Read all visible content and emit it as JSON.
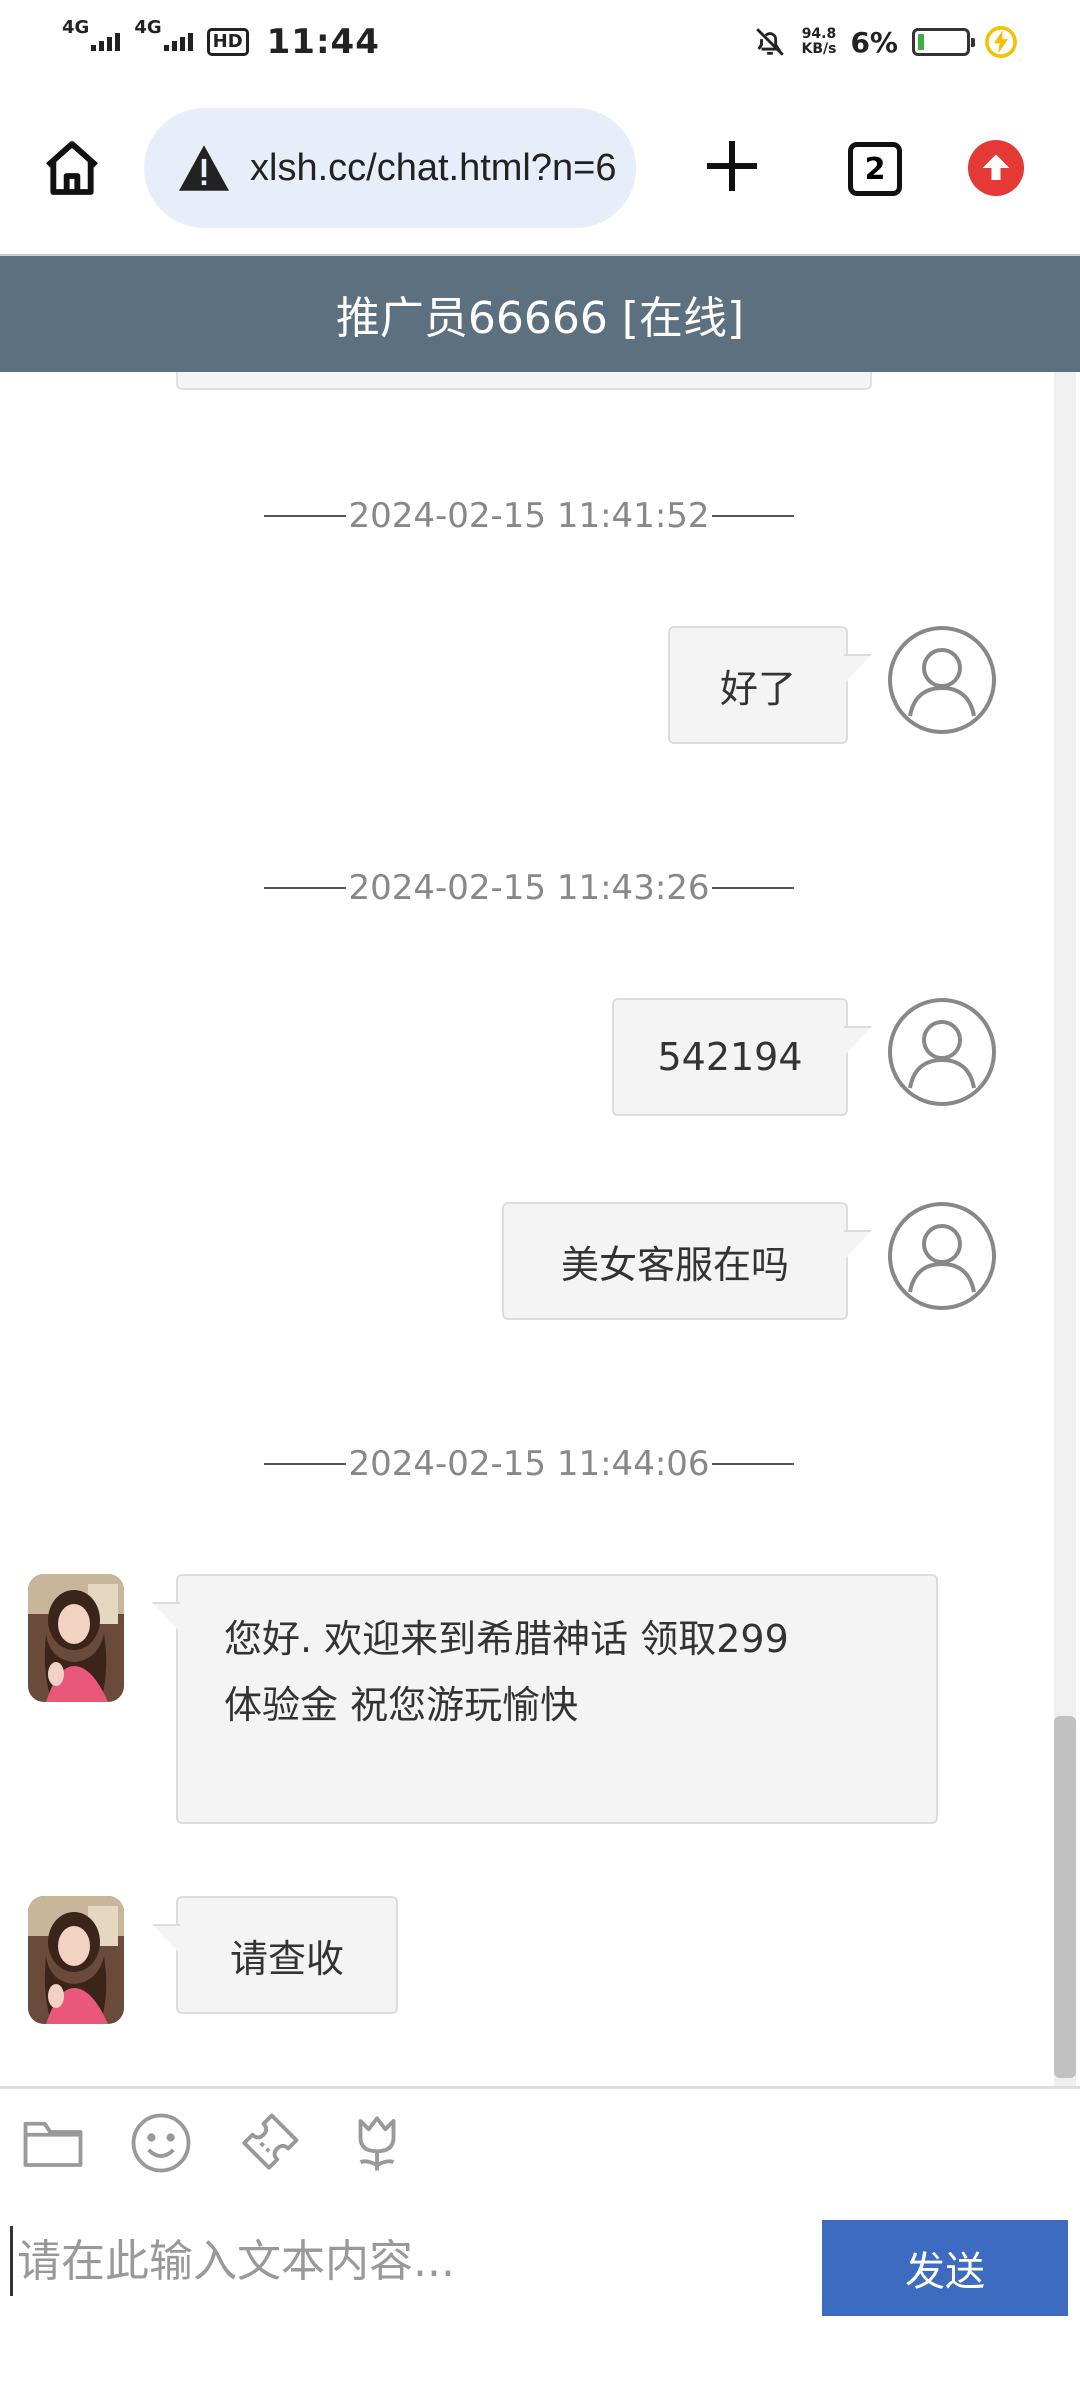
{
  "status_bar": {
    "signal1_label": "4G",
    "signal2_label": "4G",
    "hd_label": "HD",
    "time": "11:44",
    "net_speed_value": "94.8",
    "net_speed_unit": "KB/s",
    "battery_percent": "6%"
  },
  "browser": {
    "url": "xlsh.cc/chat.html?n=6",
    "tab_count": "2"
  },
  "chat": {
    "title": "推广员66666 [在线]",
    "messages": [
      {
        "type": "time",
        "text": "2024-02-15 11:41:52"
      },
      {
        "type": "sent",
        "text": "好了"
      },
      {
        "type": "time",
        "text": "2024-02-15 11:43:26"
      },
      {
        "type": "sent",
        "text": "542194"
      },
      {
        "type": "sent",
        "text": "美女客服在吗"
      },
      {
        "type": "time",
        "text": "2024-02-15 11:44:06"
      },
      {
        "type": "received",
        "lines": [
          "您好. 欢迎来到希腊神话   领取299",
          "体验金  祝您游玩愉快"
        ]
      },
      {
        "type": "received",
        "text": "请查收"
      }
    ]
  },
  "composer": {
    "placeholder": "请在此输入文本内容...",
    "send_label": "发送",
    "tools": [
      "folder-icon",
      "emoji-icon",
      "ticket-icon",
      "flower-icon"
    ]
  },
  "colors": {
    "header_bg": "#5d7080",
    "send_bg": "#3c6bbf",
    "bubble_bg": "#f4f4f4"
  }
}
